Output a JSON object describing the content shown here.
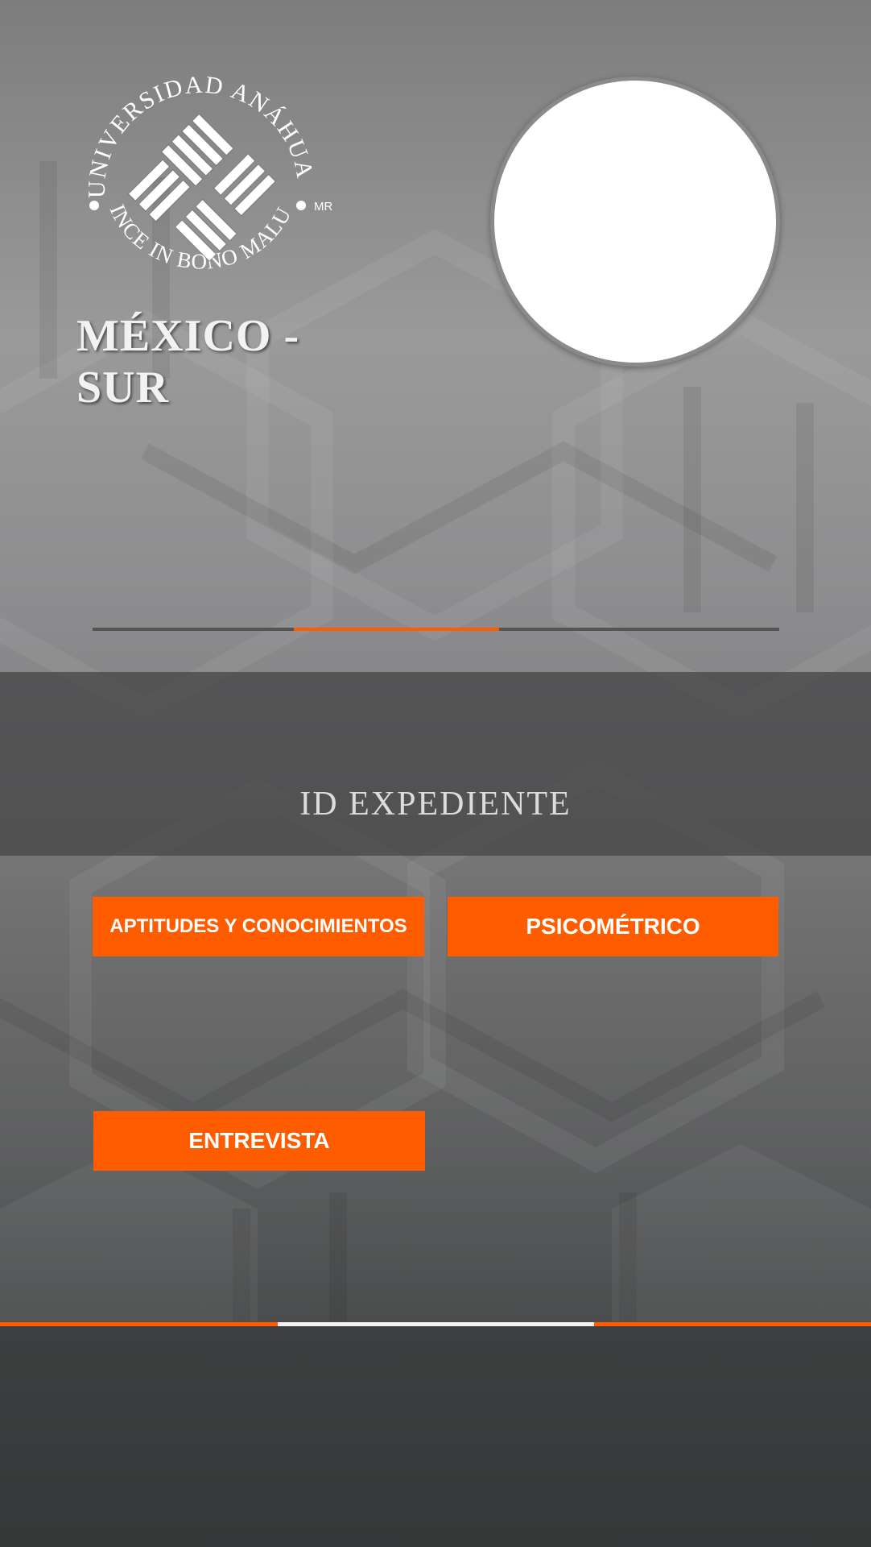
{
  "header": {
    "logo": {
      "seal_text_top": "UNIVERSIDAD ANÁHUAC",
      "seal_text_bottom": "VINCE IN BONO MALUM",
      "trademark": "MR",
      "caption": "MÉXICO - SUR"
    }
  },
  "progress": {
    "start": 0.293,
    "end": 0.592,
    "active_color": "#ff5c00",
    "track_color": "#545454"
  },
  "expediente": {
    "title": "ID EXPEDIENTE"
  },
  "buttons": {
    "aptitudes": "APTITUDES Y CONOCIMIENTOS",
    "psicometrico": "PSICOMÉTRICO",
    "entrevista": "ENTREVISTA"
  },
  "footer": {
    "accent_color": "#ff5c00",
    "active_color": "#f2f2f2"
  },
  "colors": {
    "accent": "#ff5c00",
    "band": "#464648",
    "footer": "#3a3c3d"
  }
}
